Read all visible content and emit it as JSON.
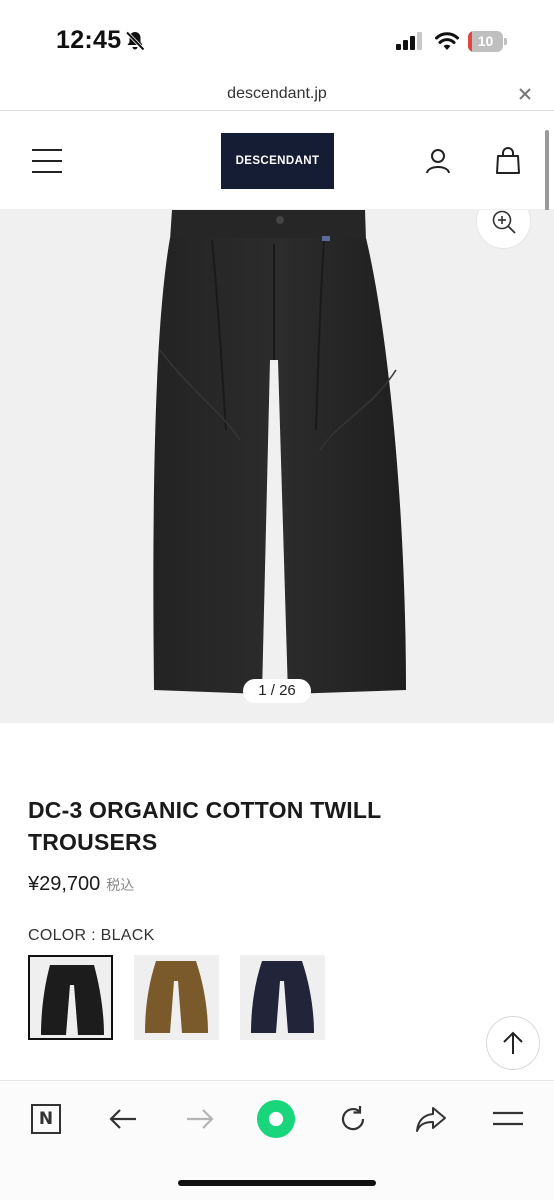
{
  "status": {
    "time": "12:45",
    "battery": "10",
    "battery_level_percent": 10
  },
  "browser": {
    "url": "descendant.jp"
  },
  "header": {
    "logo_text": "DESCENDANT",
    "logo_bg_color": "#141d33",
    "icons": [
      "menu-icon",
      "account-icon",
      "bag-icon"
    ]
  },
  "gallery": {
    "page_indicator": "1 / 26",
    "current_page": 1,
    "total_pages": 26,
    "background_color": "#f0f0f0"
  },
  "product": {
    "title": "DC-3 ORGANIC COTTON TWILL TROUSERS",
    "price": "¥29,700",
    "tax_label": "税込",
    "color_label": "COLOR : BLACK",
    "swatches": [
      {
        "color": "BLACK",
        "hex": "#1c1c1c",
        "selected": true
      },
      {
        "color": "BROWN",
        "hex": "#7a5a2a",
        "selected": false
      },
      {
        "color": "NAVY",
        "hex": "#22253a",
        "selected": false
      }
    ]
  },
  "toolbar": {
    "items": [
      "n-icon",
      "back-icon",
      "forward-icon",
      "home-icon",
      "reload-icon",
      "share-icon",
      "menu-icon"
    ],
    "n_label": "N",
    "accent_color": "#19d67d"
  }
}
